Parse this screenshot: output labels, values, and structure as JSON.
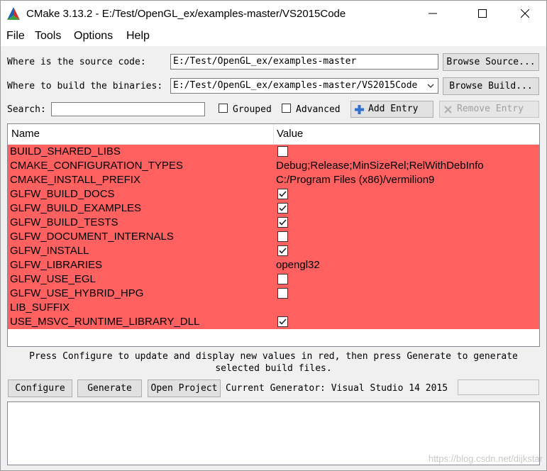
{
  "window": {
    "title": "CMake 3.13.2 - E:/Test/OpenGL_ex/examples-master/VS2015Code"
  },
  "menu": [
    {
      "label": "File"
    },
    {
      "label": "Tools"
    },
    {
      "label": "Options"
    },
    {
      "label": "Help"
    }
  ],
  "source": {
    "label": "Where is the source code:",
    "value": "E:/Test/OpenGL_ex/examples-master",
    "button": "Browse Source..."
  },
  "build": {
    "label": "Where to build the binaries:",
    "value": "E:/Test/OpenGL_ex/examples-master/VS2015Code",
    "button": "Browse Build..."
  },
  "search": {
    "label": "Search:",
    "value": ""
  },
  "options": {
    "grouped_label": "Grouped",
    "grouped_checked": false,
    "advanced_label": "Advanced",
    "advanced_checked": false,
    "add_entry": "Add Entry",
    "remove_entry": "Remove Entry"
  },
  "table": {
    "headers": [
      "Name",
      "Value"
    ],
    "highlight_color": "#ff6060",
    "rows": [
      {
        "name": "BUILD_SHARED_LIBS",
        "type": "bool",
        "checked": false,
        "value": ""
      },
      {
        "name": "CMAKE_CONFIGURATION_TYPES",
        "type": "text",
        "checked": false,
        "value": "Debug;Release;MinSizeRel;RelWithDebInfo"
      },
      {
        "name": "CMAKE_INSTALL_PREFIX",
        "type": "text",
        "checked": false,
        "value": "C:/Program Files (x86)/vermilion9"
      },
      {
        "name": "GLFW_BUILD_DOCS",
        "type": "bool",
        "checked": true,
        "value": ""
      },
      {
        "name": "GLFW_BUILD_EXAMPLES",
        "type": "bool",
        "checked": true,
        "value": ""
      },
      {
        "name": "GLFW_BUILD_TESTS",
        "type": "bool",
        "checked": true,
        "value": ""
      },
      {
        "name": "GLFW_DOCUMENT_INTERNALS",
        "type": "bool",
        "checked": false,
        "value": ""
      },
      {
        "name": "GLFW_INSTALL",
        "type": "bool",
        "checked": true,
        "value": ""
      },
      {
        "name": "GLFW_LIBRARIES",
        "type": "text",
        "checked": false,
        "value": "opengl32"
      },
      {
        "name": "GLFW_USE_EGL",
        "type": "bool",
        "checked": false,
        "value": ""
      },
      {
        "name": "GLFW_USE_HYBRID_HPG",
        "type": "bool",
        "checked": false,
        "value": ""
      },
      {
        "name": "LIB_SUFFIX",
        "type": "text",
        "checked": false,
        "value": ""
      },
      {
        "name": "USE_MSVC_RUNTIME_LIBRARY_DLL",
        "type": "bool",
        "checked": true,
        "value": ""
      }
    ]
  },
  "info": {
    "line1": "Press Configure to update and display new values in red, then press Generate to generate",
    "line2": "selected build files."
  },
  "actions": {
    "configure": "Configure",
    "generate": "Generate",
    "open_project": "Open Project",
    "current_generator": "Current Generator: Visual Studio 14 2015"
  },
  "watermark": "https://blog.csdn.net/dijkstar"
}
